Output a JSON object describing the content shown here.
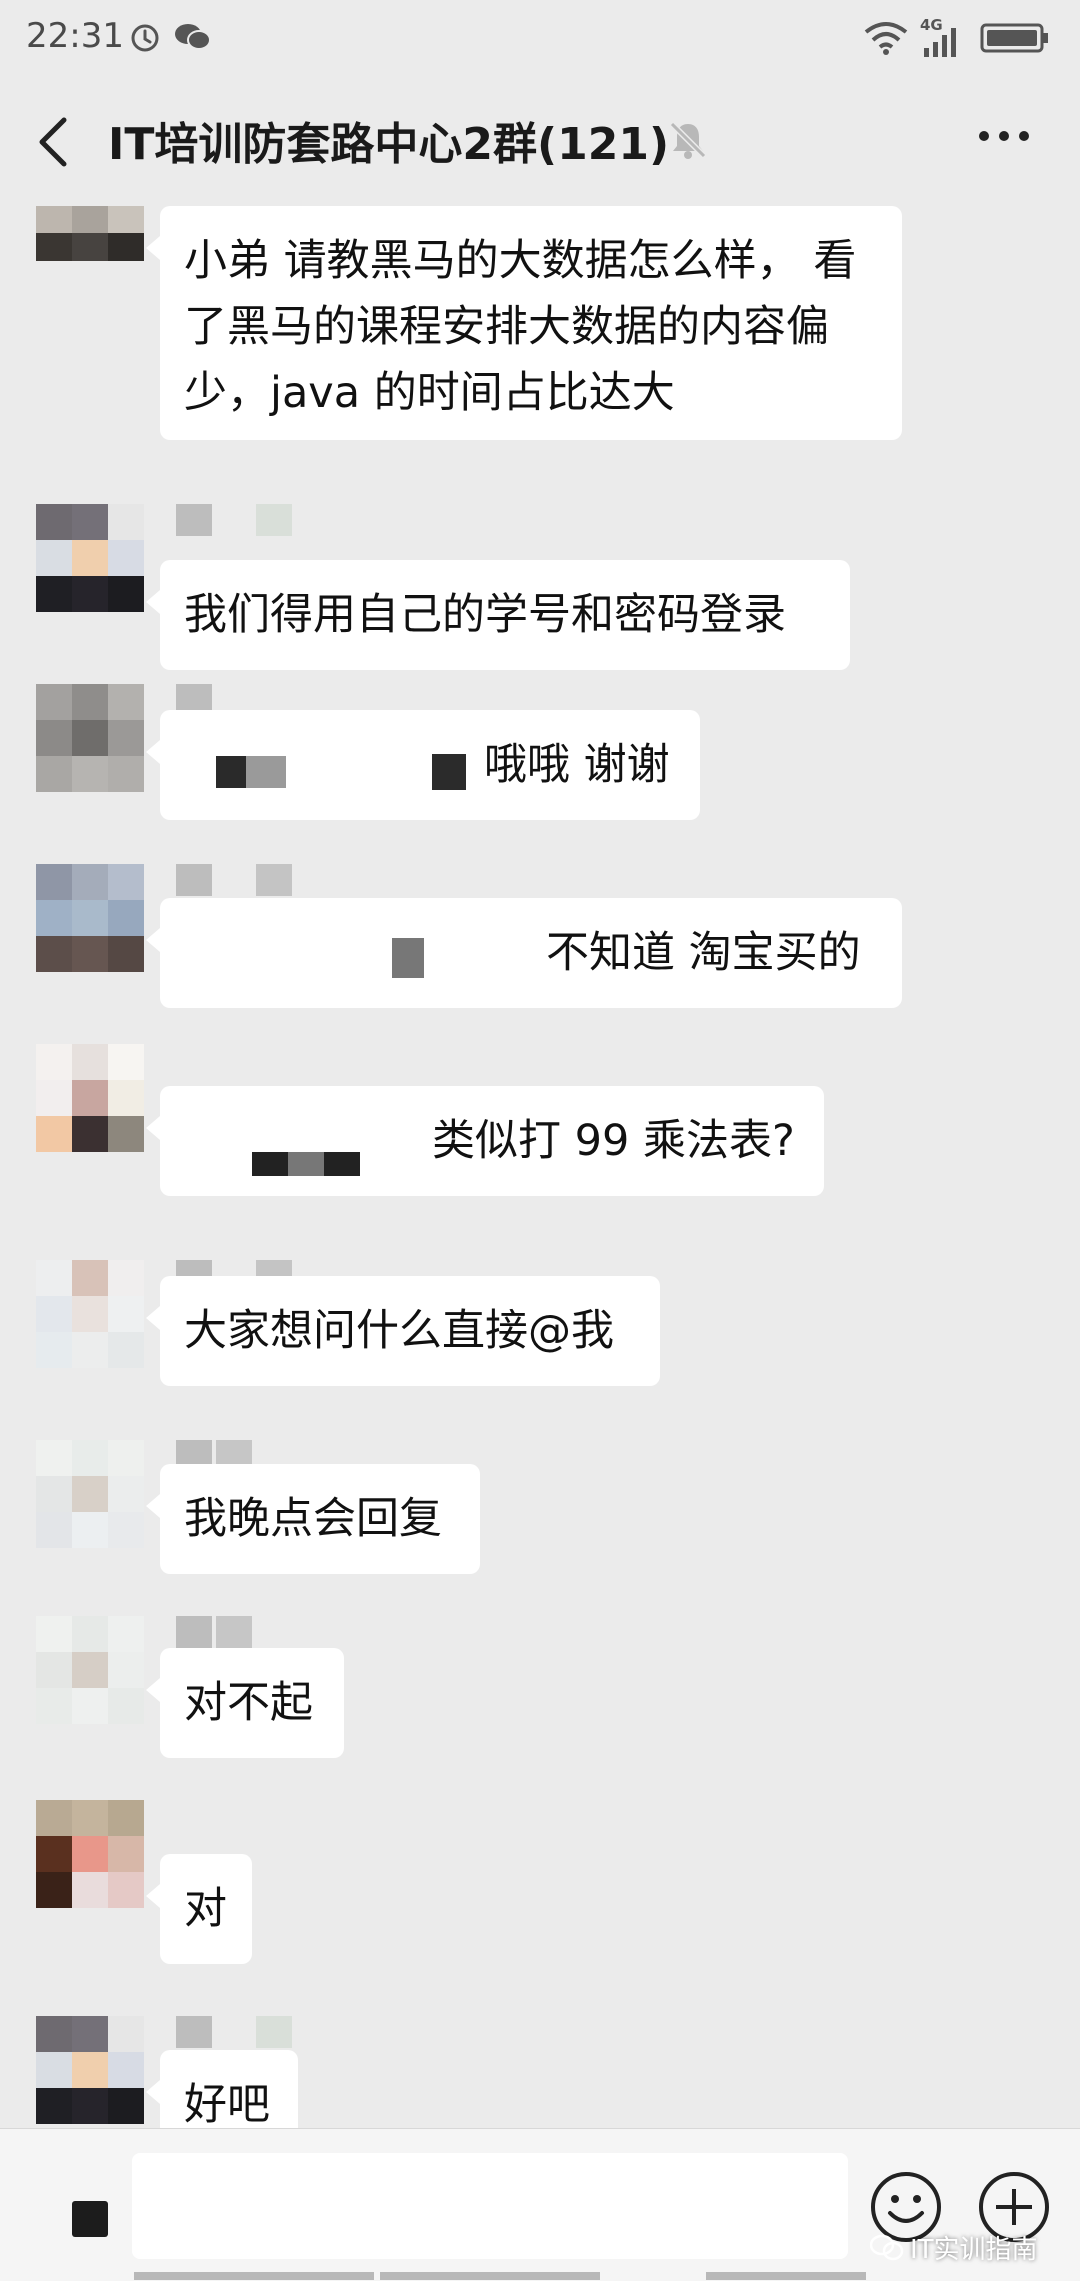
{
  "status_bar": {
    "time": "22:31",
    "network_label": "4G"
  },
  "title_bar": {
    "title": "IT培训防套路中心2群(121)"
  },
  "messages": [
    {
      "text": "小弟 请教黑马的大数据怎么样， 看\n了黑马的课程安排大数据的内容偏\n少，java 的时间占比达大"
    },
    {
      "text": "我们得用自己的学号和密码登录"
    },
    {
      "text": "哦哦 谢谢"
    },
    {
      "text": "不知道 淘宝买的"
    },
    {
      "text": "类似打 99 乘法表?"
    },
    {
      "text": "大家想问什么直接@我"
    },
    {
      "text": "我晚点会回复"
    },
    {
      "text": "对不起"
    },
    {
      "text": "对"
    },
    {
      "text": "好吧"
    }
  ],
  "input_bar": {
    "placeholder": ""
  },
  "watermark": {
    "text": "IT实训指南"
  },
  "colors": {
    "background": "#ebebeb",
    "bubble": "#ffffff",
    "title_text": "#1a1a1a"
  },
  "icons": [
    "alarm-icon",
    "chat-app-icon",
    "wifi-icon",
    "signal-icon",
    "battery-icon",
    "back-icon",
    "mute-icon",
    "more-icon",
    "voice-toggle-icon",
    "emoji-icon",
    "add-icon"
  ]
}
